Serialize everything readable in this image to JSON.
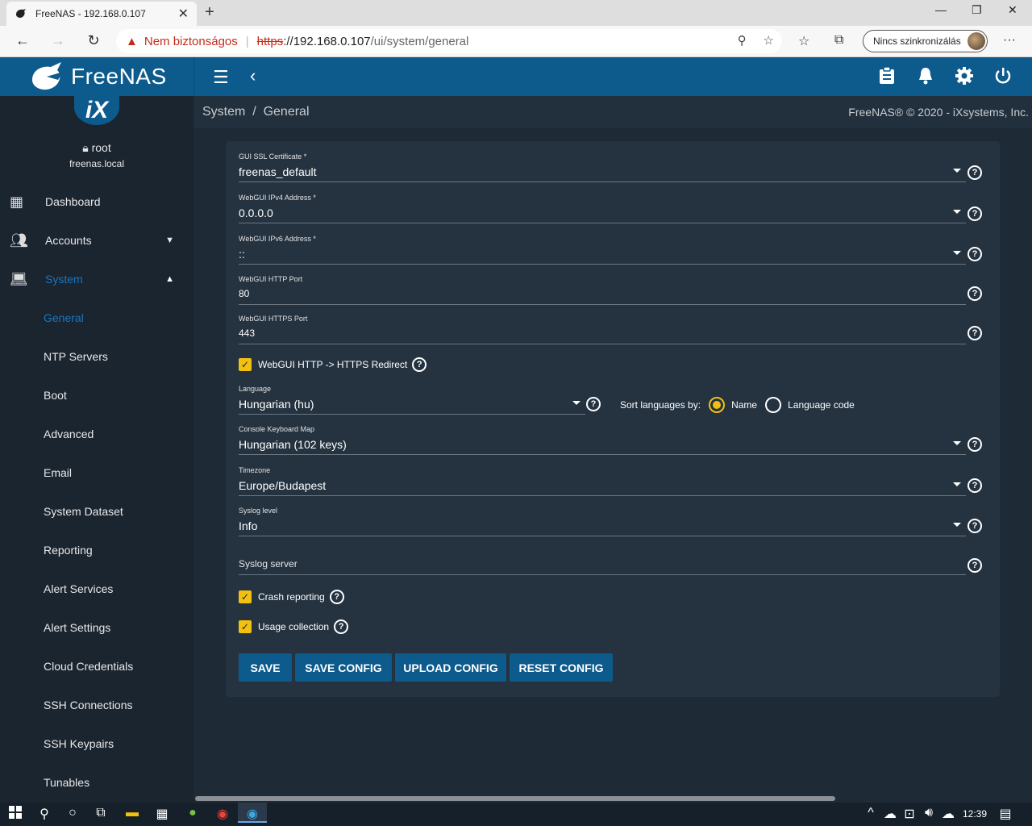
{
  "browser": {
    "tab_title": "FreeNAS - 192.168.0.107",
    "security_label": "Nem biztonságos",
    "url_scheme": "https",
    "url_host": "://192.168.0.107",
    "url_path": "/ui/system/general",
    "sync_label": "Nincs szinkronizálás"
  },
  "app": {
    "brand": "FreeNAS",
    "ix_logo": "iX",
    "user": "root",
    "host": "freenas.local",
    "breadcrumb_root": "System",
    "breadcrumb_sep": "/",
    "breadcrumb_page": "General",
    "copyright": "FreeNAS® © 2020 - iXsystems, Inc."
  },
  "sidebar": {
    "dashboard": "Dashboard",
    "accounts": "Accounts",
    "system": "System",
    "sub": [
      "General",
      "NTP Servers",
      "Boot",
      "Advanced",
      "Email",
      "System Dataset",
      "Reporting",
      "Alert Services",
      "Alert Settings",
      "Cloud Credentials",
      "SSH Connections",
      "SSH Keypairs",
      "Tunables"
    ]
  },
  "form": {
    "ssl_label": "GUI SSL Certificate *",
    "ssl_value": "freenas_default",
    "ipv4_label": "WebGUI IPv4 Address *",
    "ipv4_value": "0.0.0.0",
    "ipv6_label": "WebGUI IPv6 Address *",
    "ipv6_value": "::",
    "http_label": "WebGUI HTTP Port",
    "http_value": "80",
    "https_label": "WebGUI HTTPS Port",
    "https_value": "443",
    "redirect_label": "WebGUI HTTP -> HTTPS Redirect",
    "language_label": "Language",
    "language_value": "Hungarian (hu)",
    "sort_label": "Sort languages by:",
    "sort_name": "Name",
    "sort_code": "Language code",
    "kbd_label": "Console Keyboard Map",
    "kbd_value": "Hungarian (102 keys)",
    "tz_label": "Timezone",
    "tz_value": "Europe/Budapest",
    "syslog_level_label": "Syslog level",
    "syslog_level_value": "Info",
    "syslog_server_placeholder": "Syslog server",
    "crash_label": "Crash reporting",
    "usage_label": "Usage collection",
    "help_glyph": "?",
    "save": "SAVE",
    "save_config": "SAVE CONFIG",
    "upload_config": "UPLOAD CONFIG",
    "reset_config": "RESET CONFIG"
  },
  "taskbar": {
    "time": "12:39"
  },
  "colors": {
    "brand": "#0d5a8c",
    "accent": "#f2c00f",
    "active_nav": "#1776c0"
  }
}
